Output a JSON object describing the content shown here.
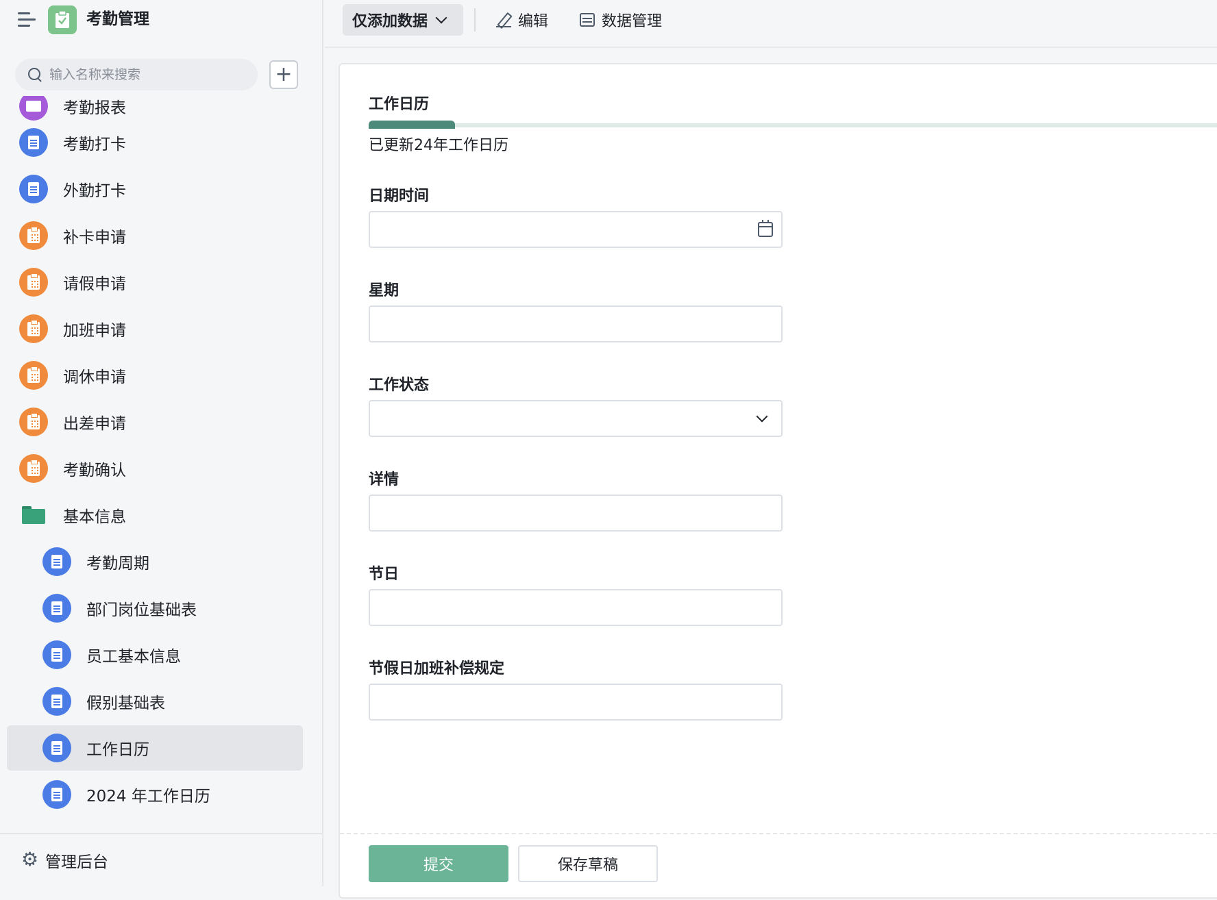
{
  "app": {
    "title": "考勤管理"
  },
  "sidebar": {
    "search_placeholder": "输入名称来搜索",
    "add_label": "+",
    "items": [
      {
        "label": "考勤报表",
        "icon": "monitor-icon",
        "color": "#a45ad9"
      },
      {
        "label": "考勤打卡",
        "icon": "document-icon",
        "color": "#4b7be5"
      },
      {
        "label": "外勤打卡",
        "icon": "document-icon",
        "color": "#4b7be5"
      },
      {
        "label": "补卡申请",
        "icon": "clipboard-icon",
        "color": "#f08a3c"
      },
      {
        "label": "请假申请",
        "icon": "clipboard-icon",
        "color": "#f08a3c"
      },
      {
        "label": "加班申请",
        "icon": "clipboard-icon",
        "color": "#f08a3c"
      },
      {
        "label": "调休申请",
        "icon": "clipboard-icon",
        "color": "#f08a3c"
      },
      {
        "label": "出差申请",
        "icon": "clipboard-icon",
        "color": "#f08a3c"
      },
      {
        "label": "考勤确认",
        "icon": "clipboard-icon",
        "color": "#f08a3c"
      },
      {
        "label": "基本信息",
        "icon": "folder-icon",
        "color": "#3aa27a"
      },
      {
        "label": "考勤周期",
        "icon": "document-icon",
        "color": "#4b7be5"
      },
      {
        "label": "部门岗位基础表",
        "icon": "document-icon",
        "color": "#4b7be5"
      },
      {
        "label": "员工基本信息",
        "icon": "document-icon",
        "color": "#4b7be5"
      },
      {
        "label": "假别基础表",
        "icon": "document-icon",
        "color": "#4b7be5"
      },
      {
        "label": "工作日历",
        "icon": "document-icon",
        "color": "#4b7be5",
        "active": true
      },
      {
        "label": "2024 年工作日历",
        "icon": "document-icon",
        "color": "#4b7be5"
      }
    ],
    "footer_label": "管理后台"
  },
  "toolbar": {
    "mode_label": "仅添加数据",
    "edit_label": "编辑",
    "data_label": "数据管理"
  },
  "form": {
    "title": "工作日历",
    "progress_text": "已更新24年工作日历",
    "progress_fraction": 0.1,
    "fields": {
      "date_label": "日期时间",
      "weekday_label": "星期",
      "status_label": "工作状态",
      "detail_label": "详情",
      "holiday_label": "节日",
      "rule_label": "节假日加班补偿规定"
    },
    "submit_label": "提交",
    "draft_label": "保存草稿"
  },
  "colors": {
    "accent": "#6cb497",
    "progress": "#4d8a7a",
    "active_item_bg": "#e4e5e8"
  }
}
